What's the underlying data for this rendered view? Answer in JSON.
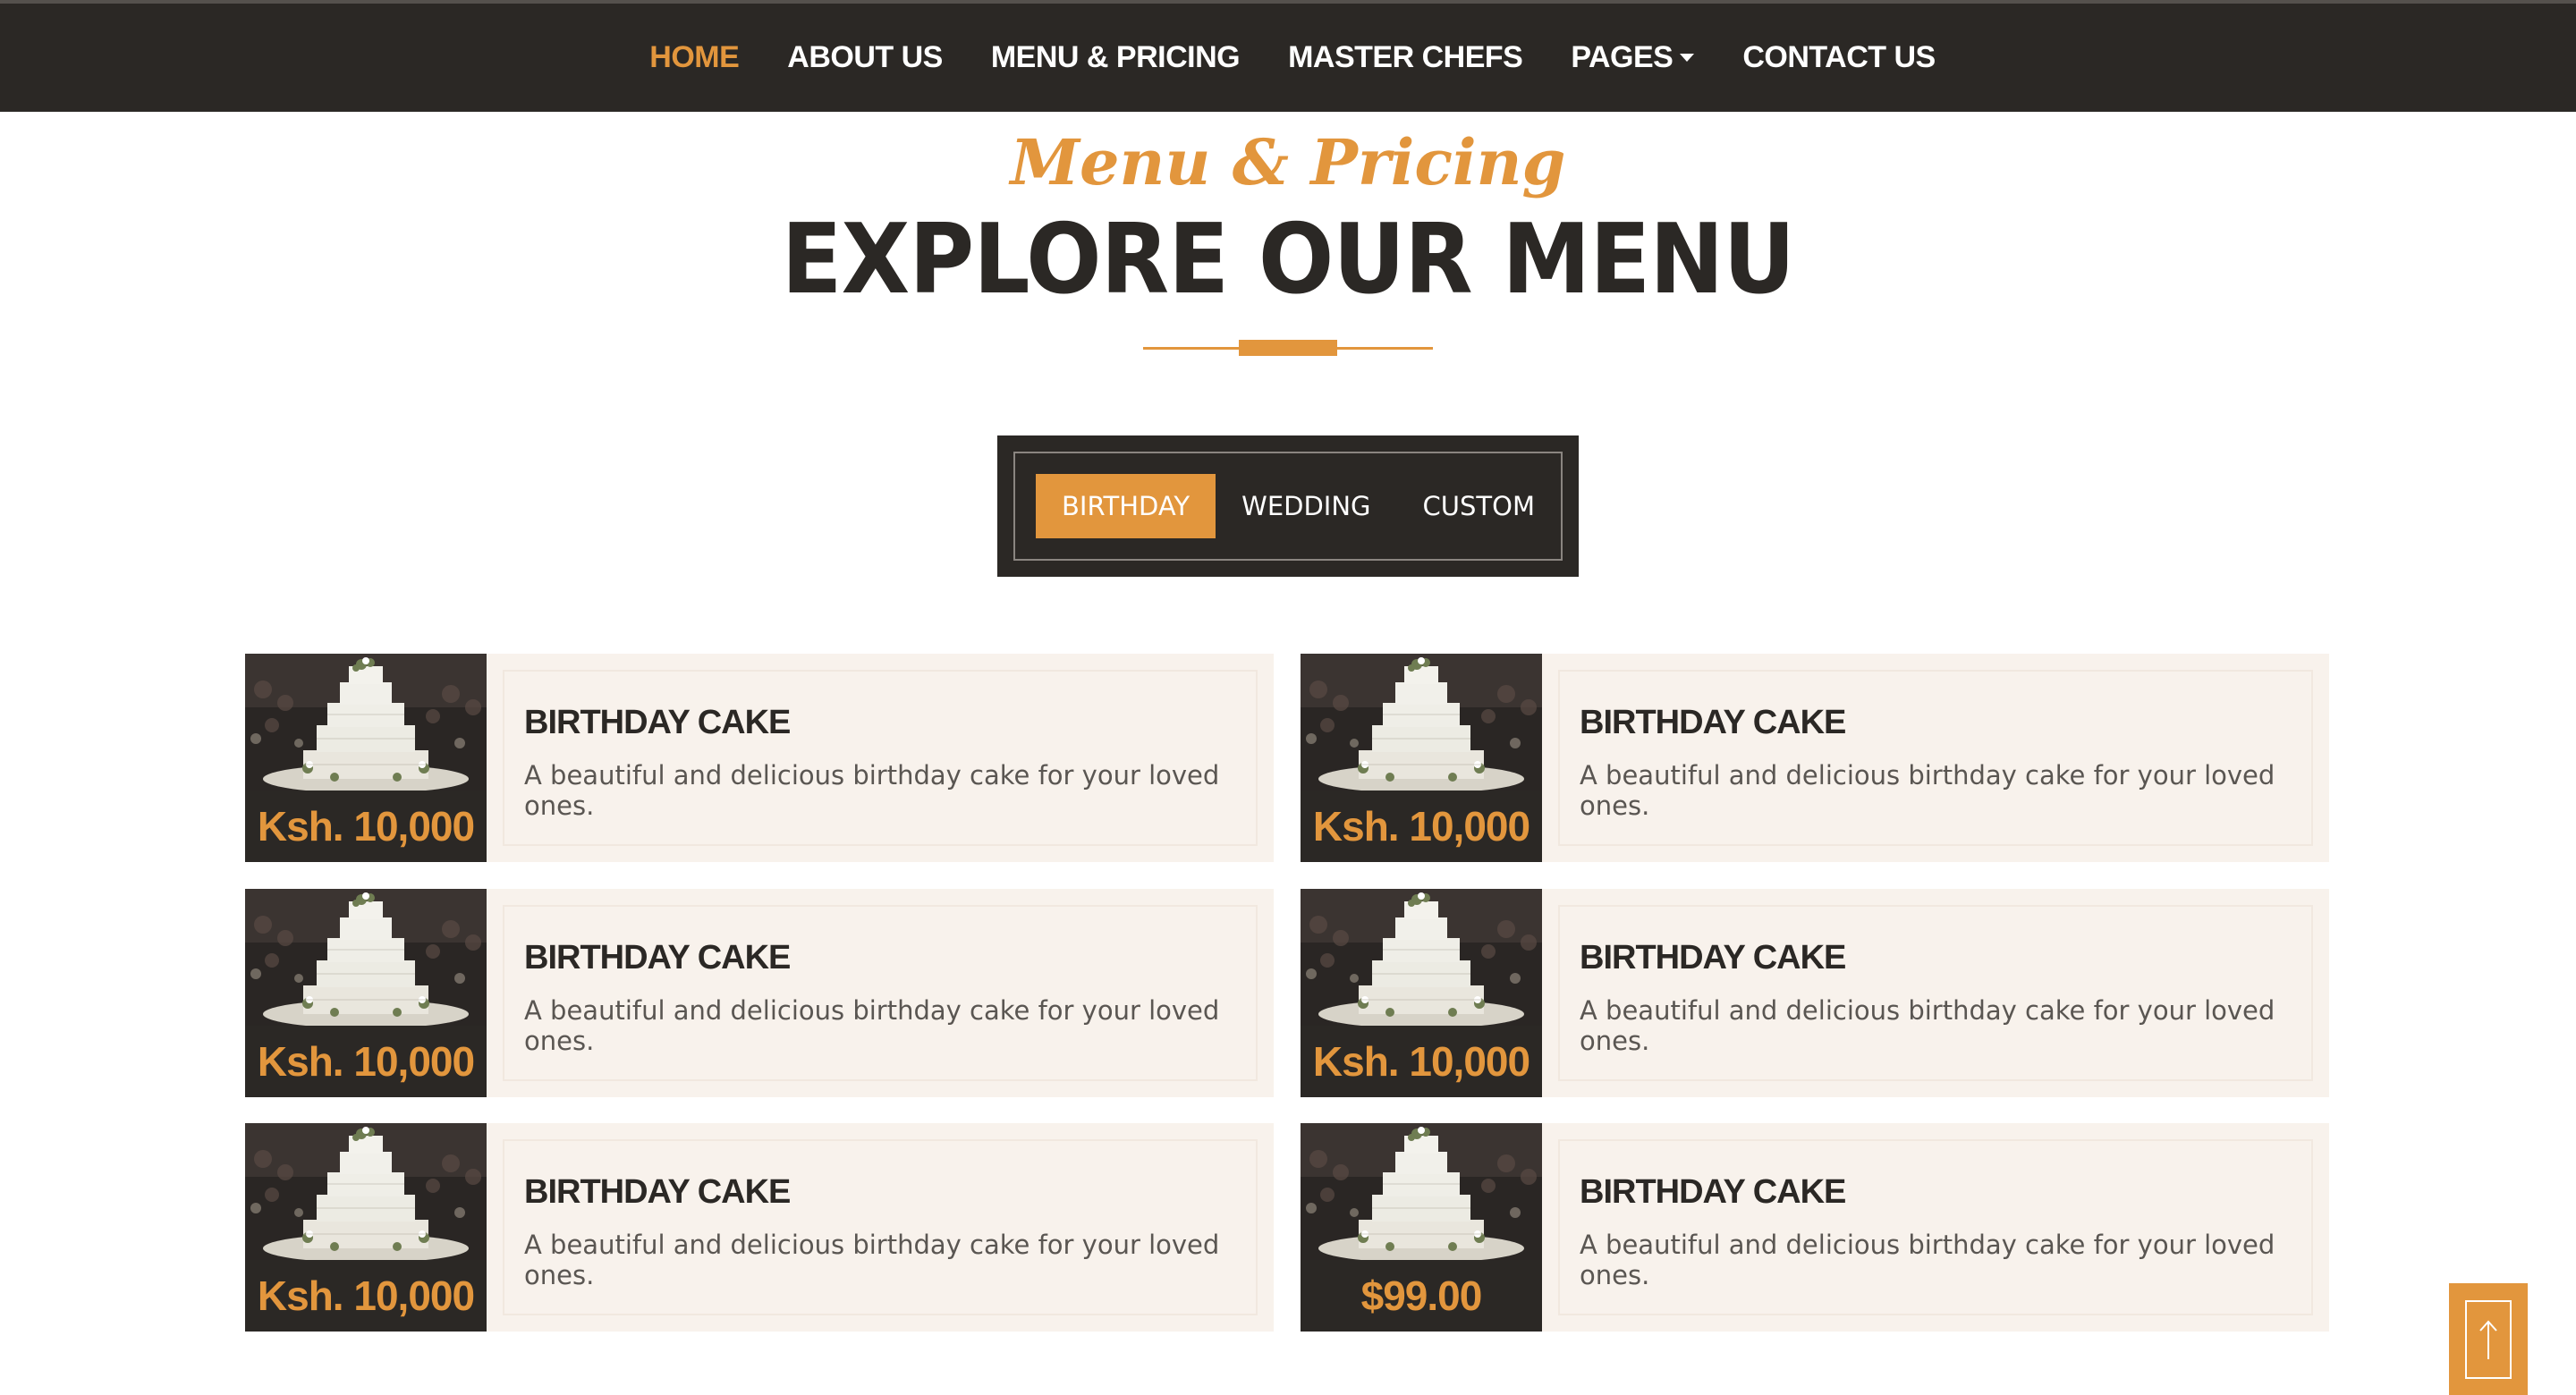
{
  "nav": {
    "items": [
      {
        "label": "HOME",
        "active": true
      },
      {
        "label": "ABOUT US"
      },
      {
        "label": "MENU & PRICING"
      },
      {
        "label": "MASTER CHEFS"
      },
      {
        "label": "PAGES",
        "dropdown": true
      },
      {
        "label": "CONTACT US"
      }
    ]
  },
  "header": {
    "subtitle": "Menu & Pricing",
    "title": "EXPLORE OUR MENU"
  },
  "tabs": [
    {
      "label": "BIRTHDAY",
      "active": true
    },
    {
      "label": "WEDDING"
    },
    {
      "label": "CUSTOM"
    }
  ],
  "menu_items": [
    {
      "title": "BIRTHDAY CAKE",
      "description": "A beautiful and delicious birthday cake for your loved ones.",
      "price": "Ksh. 10,000"
    },
    {
      "title": "BIRTHDAY CAKE",
      "description": "A beautiful and delicious birthday cake for your loved ones.",
      "price": "Ksh. 10,000"
    },
    {
      "title": "BIRTHDAY CAKE",
      "description": "A beautiful and delicious birthday cake for your loved ones.",
      "price": "Ksh. 10,000"
    },
    {
      "title": "BIRTHDAY CAKE",
      "description": "A beautiful and delicious birthday cake for your loved ones.",
      "price": "Ksh. 10,000"
    },
    {
      "title": "BIRTHDAY CAKE",
      "description": "A beautiful and delicious birthday cake for your loved ones.",
      "price": "Ksh. 10,000"
    },
    {
      "title": "BIRTHDAY CAKE",
      "description": "A beautiful and delicious birthday cake for your loved ones.",
      "price": "$99.00"
    }
  ],
  "icons": {
    "back_to_top": "arrow-up-icon",
    "thumbnail": "cake-image"
  },
  "colors": {
    "accent": "#e2963d",
    "dark": "#2b2825",
    "card_bg": "#f8f2ec"
  }
}
